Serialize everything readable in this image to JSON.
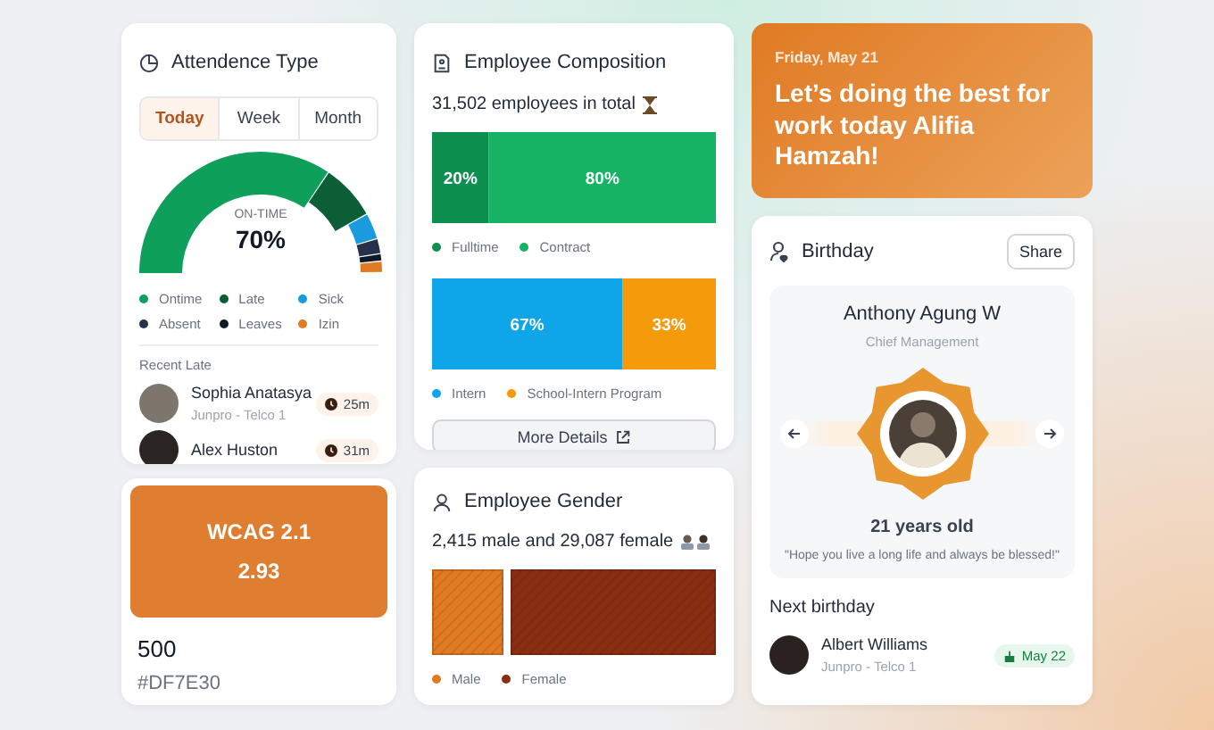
{
  "attendance": {
    "title": "Attendence Type",
    "tabs": [
      {
        "label": "Today",
        "selected": true
      },
      {
        "label": "Week",
        "selected": false
      },
      {
        "label": "Month",
        "selected": false
      }
    ],
    "gauge_label": "ON-TIME",
    "gauge_value": "70%",
    "legend": [
      {
        "label": "Ontime",
        "color": "#0e9f5a"
      },
      {
        "label": "Late",
        "color": "#0b5e36"
      },
      {
        "label": "Sick",
        "color": "#1a9be0"
      },
      {
        "label": "Absent",
        "color": "#26324a"
      },
      {
        "label": "Leaves",
        "color": "#111827"
      },
      {
        "label": "Izin",
        "color": "#e07a23"
      }
    ],
    "recent_title": "Recent Late",
    "recent": [
      {
        "name": "Sophia Anatasya",
        "sub": "Junpro - Telco 1",
        "time": "25m"
      },
      {
        "name": "Alex Huston",
        "time": "31m"
      }
    ]
  },
  "swatch": {
    "title": "WCAG 2.1",
    "ratio": "2.93",
    "shade": "500",
    "hex": "#DF7E30"
  },
  "composition": {
    "title": "Employee Composition",
    "total": "31,502 employees in total",
    "charts": [
      {
        "chart_data": {
          "type": "bar",
          "orientation": "horizontal",
          "stacked": true,
          "categories": [
            null
          ],
          "series": [
            {
              "name": "Fulltime",
              "color": "#0c8f4f",
              "values": [
                20
              ],
              "value_labels": [
                "20%"
              ]
            },
            {
              "name": "Contract",
              "color": "#16b364",
              "values": [
                80
              ],
              "value_labels": [
                "80%"
              ]
            }
          ]
        }
      },
      {
        "chart_data": {
          "type": "bar",
          "orientation": "horizontal",
          "stacked": true,
          "categories": [
            null
          ],
          "series": [
            {
              "name": "Intern",
              "color": "#0ea5e9",
              "values": [
                67
              ],
              "value_labels": [
                "67%"
              ]
            },
            {
              "name": "School-Intern Program",
              "color": "#f59a0b",
              "values": [
                33
              ],
              "value_labels": [
                "33%"
              ]
            }
          ]
        }
      }
    ],
    "button": "More Details"
  },
  "gender": {
    "title": "Employee Gender",
    "summary": "2,415 male and 29,087 female",
    "legend": [
      {
        "label": "Male",
        "color": "#e07a23"
      },
      {
        "label": "Female",
        "color": "#8a2e12"
      }
    ]
  },
  "banner": {
    "date": "Friday, May 21",
    "message": "Let’s doing the best for work today Alifia Hamzah!"
  },
  "birthday": {
    "title": "Birthday",
    "share": "Share",
    "name": "Anthony Agung W",
    "role": "Chief Management",
    "age": "21 years old",
    "wish": "\"Hope you live a long life and always be blessed!\"",
    "next_title": "Next birthday",
    "next": [
      {
        "name": "Albert Williams",
        "sub": "Junpro - Telco 1",
        "date": "May 22"
      }
    ]
  }
}
